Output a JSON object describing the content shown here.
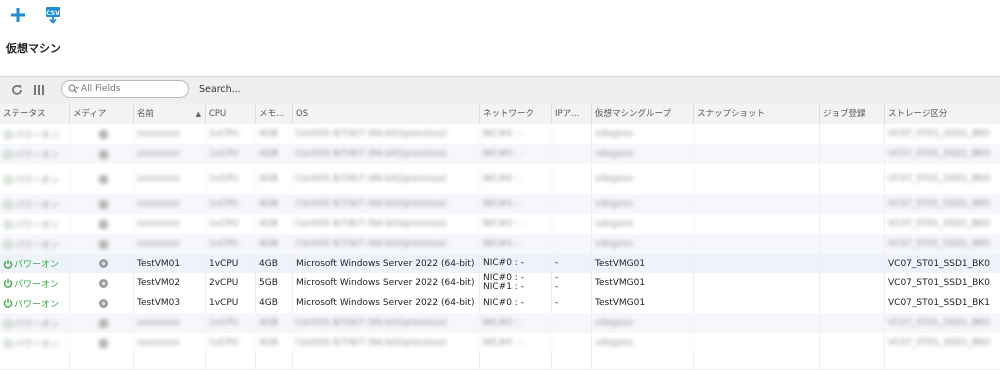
{
  "toolbar_top": {
    "add_icon": "plus-icon",
    "csv_icon": "csv-export-icon",
    "accent": "#1a8fd6"
  },
  "page_title": "仮想マシン",
  "grid_toolbar": {
    "refresh_icon": "refresh-icon",
    "columns_icon": "columns-icon",
    "search_placeholder": "All Fields",
    "search_button": "Search..."
  },
  "columns": [
    "ステータス",
    "メディア",
    "名前",
    "CPU",
    "メモ...",
    "OS",
    "ネットワーク",
    "IPア...",
    "仮想マシングループ",
    "スナップショット",
    "ジョブ登録",
    "ストレージ区分"
  ],
  "blur_rows": {
    "status": "パワーオン",
    "name": "xxxxxxxx",
    "cpu": "1vCPU",
    "mem": "4GB",
    "os": "CentOS 8/7/6/7 (64-bit)(previous)",
    "net": "NIC#0 : -",
    "group": "vdxgxxx",
    "storage": "VC07_ST01_SSD1_BK0"
  },
  "rows": [
    {
      "status": "パワーオン",
      "name": "TestVM01",
      "cpu": "1vCPU",
      "mem": "4GB",
      "os": "Microsoft Windows Server 2022 (64-bit)",
      "net": [
        "NIC#0 : -"
      ],
      "ip": [
        "-"
      ],
      "group": "TestVMG01",
      "storage": "VC07_ST01_SSD1_BK0"
    },
    {
      "status": "パワーオン",
      "name": "TestVM02",
      "cpu": "2vCPU",
      "mem": "5GB",
      "os": "Microsoft Windows Server 2022 (64-bit)",
      "net": [
        "NIC#0 : -",
        "NIC#1 : -"
      ],
      "ip": [
        "-",
        "-"
      ],
      "group": "TestVMG01",
      "storage": "VC07_ST01_SSD1_BK0"
    },
    {
      "status": "パワーオン",
      "name": "TestVM03",
      "cpu": "1vCPU",
      "mem": "4GB",
      "os": "Microsoft Windows Server 2022 (64-bit)",
      "net": [
        "NIC#0 : -"
      ],
      "ip": [
        "-"
      ],
      "group": "TestVMG01",
      "storage": "VC07_ST01_SSD1_BK1"
    }
  ]
}
